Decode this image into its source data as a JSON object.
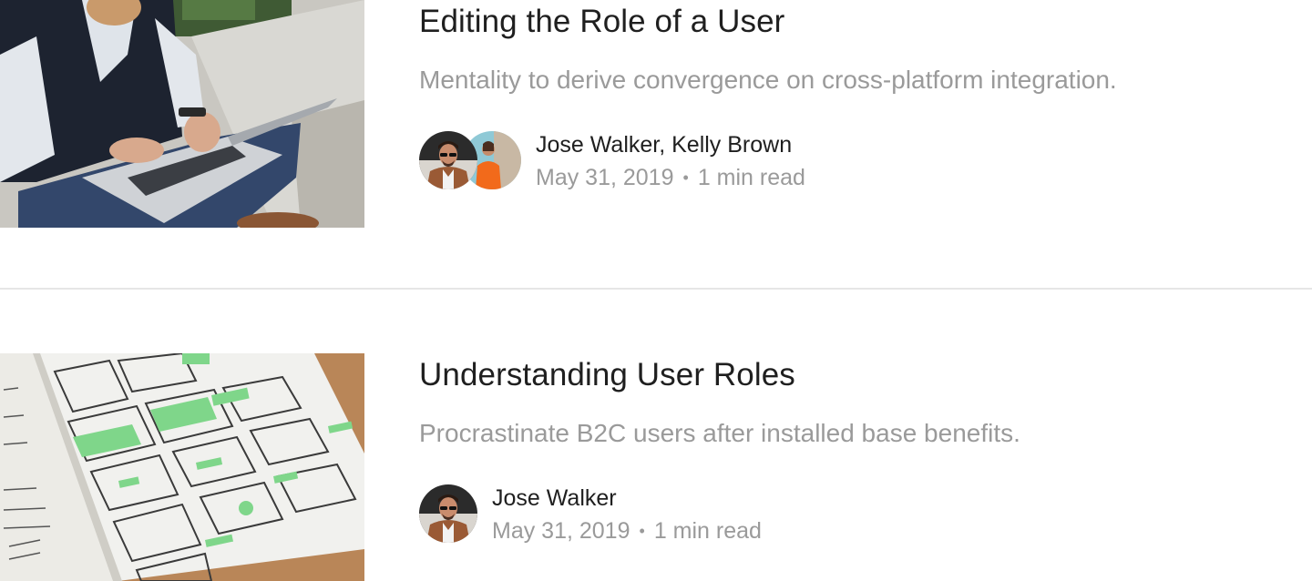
{
  "articles": [
    {
      "title": "Editing the Role of a User",
      "excerpt": "Mentality to derive convergence on cross-platform integration.",
      "authors_text": "Jose Walker, Kelly Brown",
      "date": "May 31, 2019",
      "separator": "•",
      "read_time": "1 min read",
      "thumbnail_icon": "laptop-photo"
    },
    {
      "title": "Understanding User Roles",
      "excerpt": "Procrastinate B2C users after installed base benefits.",
      "authors_text": "Jose Walker",
      "date": "May 31, 2019",
      "separator": "•",
      "read_time": "1 min read",
      "thumbnail_icon": "wireframe-sketch-photo"
    }
  ],
  "colors": {
    "title": "#1f1f1f",
    "muted": "#9a9a9a",
    "divider": "#e6e6e6"
  }
}
